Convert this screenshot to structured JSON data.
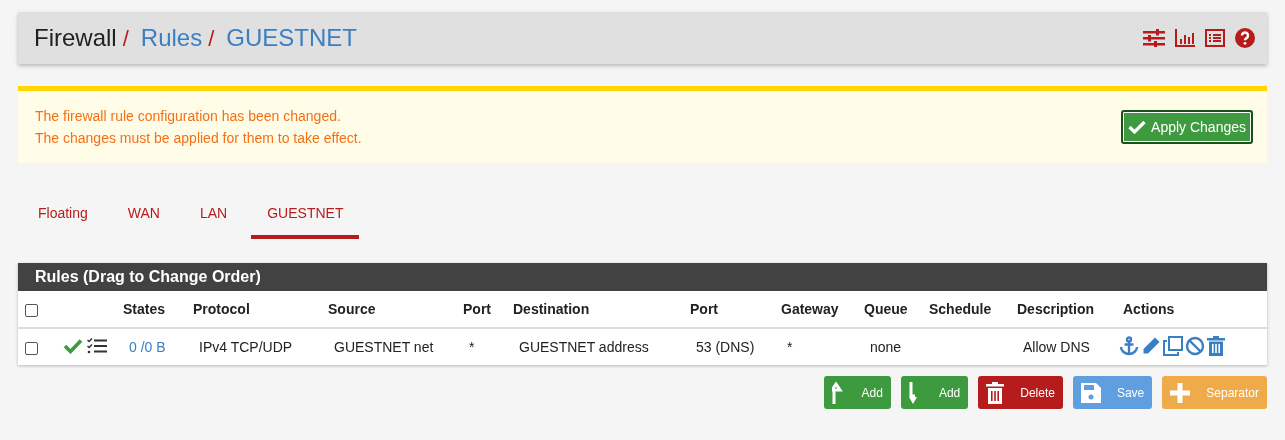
{
  "breadcrumb": [
    {
      "label": "Firewall",
      "link": false,
      "separator": "/"
    },
    {
      "label": "Rules",
      "link": true,
      "separator": "/"
    },
    {
      "label": "GUESTNET",
      "link": true
    }
  ],
  "alert": {
    "lines": [
      "The firewall rule configuration has been changed.",
      "The changes must be applied for them to take effect."
    ],
    "button": "Apply Changes"
  },
  "tabs": [
    {
      "label": "Floating",
      "selected": false
    },
    {
      "label": "WAN",
      "selected": false
    },
    {
      "label": "LAN",
      "selected": false
    },
    {
      "label": "GUESTNET",
      "selected": true
    }
  ],
  "table": {
    "title": "Rules (Drag to Change Order)",
    "select_all_checked": false,
    "columns": [
      "States",
      "Protocol",
      "Source",
      "Port",
      "Destination",
      "Port",
      "Gateway",
      "Queue",
      "Schedule",
      "Description",
      "Actions"
    ],
    "rows": [
      {
        "checked": false,
        "states": "0 /0 B",
        "protocol": "IPv4 TCP/UDP",
        "source": "GUESTNET net",
        "source_port": "*",
        "destination": "GUESTNET address",
        "destination_port": "53 (DNS)",
        "gateway": "*",
        "queue": "none",
        "description": "Allow DNS"
      }
    ]
  },
  "buttons": [
    {
      "kind": "add-top",
      "label": "Add"
    },
    {
      "kind": "add-bottom",
      "label": "Add"
    },
    {
      "kind": "delete",
      "label": "Delete"
    },
    {
      "kind": "save",
      "label": "Save"
    },
    {
      "kind": "separator",
      "label": "Separator"
    }
  ]
}
